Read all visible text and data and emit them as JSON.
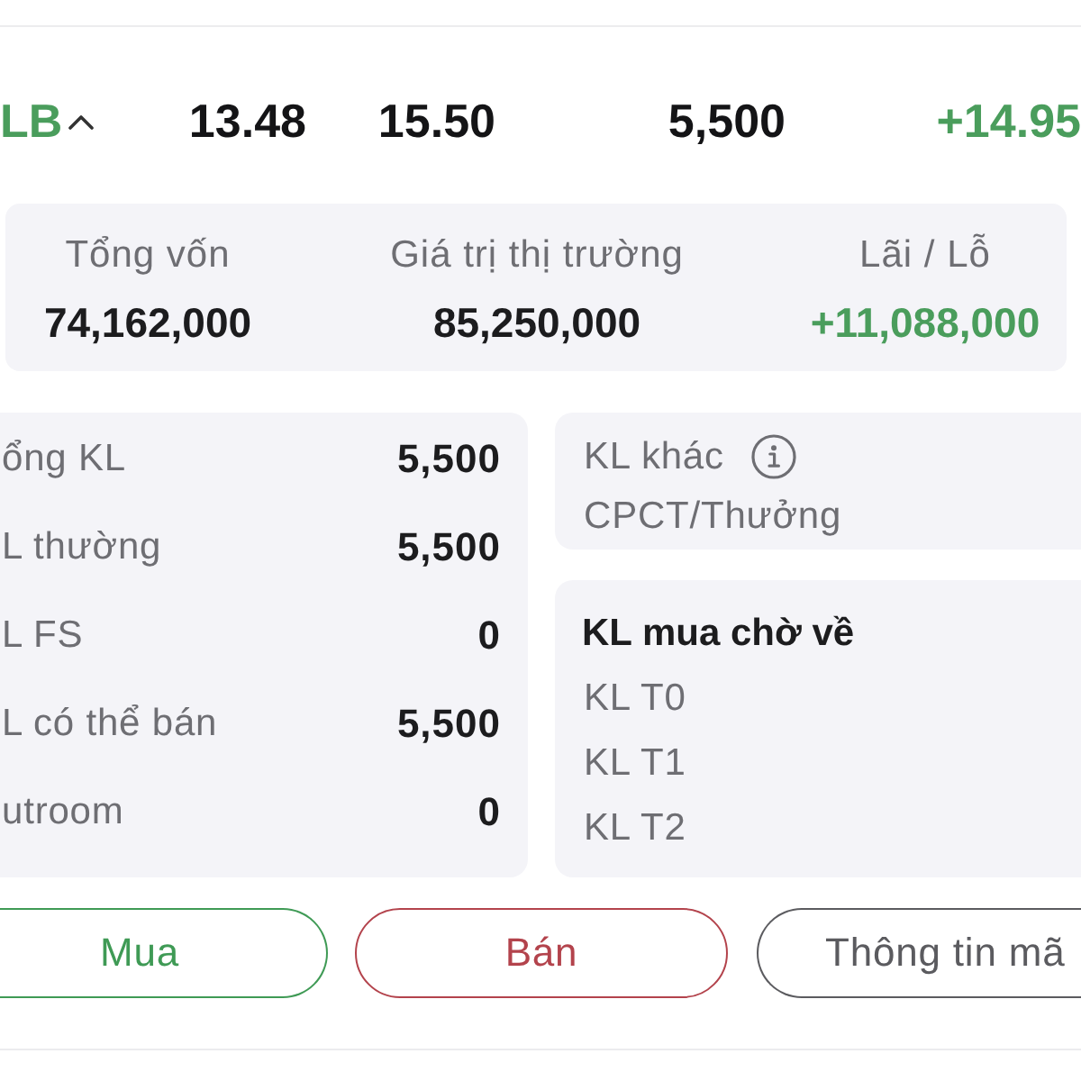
{
  "header": {
    "symbol": {
      "text": "LB",
      "positive": true
    },
    "expanded": true,
    "values": [
      {
        "text": "13.48",
        "positive": false
      },
      {
        "text": "15.50",
        "positive": false
      },
      {
        "text": "5,500",
        "positive": false
      },
      {
        "text": "+14.95",
        "positive": true
      }
    ]
  },
  "summary": [
    {
      "label": "Tổng vốn",
      "value": "74,162,000",
      "positive": false
    },
    {
      "label": "Giá trị thị trường",
      "value": "85,250,000",
      "positive": false
    },
    {
      "label": "Lãi / Lỗ",
      "value": "+11,088,000",
      "positive": true
    }
  ],
  "volumes": [
    {
      "label": "ổng KL",
      "value": "5,500"
    },
    {
      "label": "L thường",
      "value": "5,500"
    },
    {
      "label": "L FS",
      "value": "0"
    },
    {
      "label": "L có thể bán",
      "value": "5,500"
    },
    {
      "label": "utroom",
      "value": "0"
    }
  ],
  "other_volume": {
    "label": "KL khác",
    "rows": [
      {
        "label": "CPCT/Thưởng"
      }
    ]
  },
  "pending_buy": {
    "title": "KL mua chờ về",
    "rows": [
      {
        "label": "KL T0"
      },
      {
        "label": "KL T1"
      },
      {
        "label": "KL T2"
      }
    ]
  },
  "actions": [
    {
      "label": "Mua",
      "kind": "buy"
    },
    {
      "label": "Bán",
      "kind": "sell"
    },
    {
      "label": "Thông tin mã",
      "kind": "info"
    }
  ]
}
